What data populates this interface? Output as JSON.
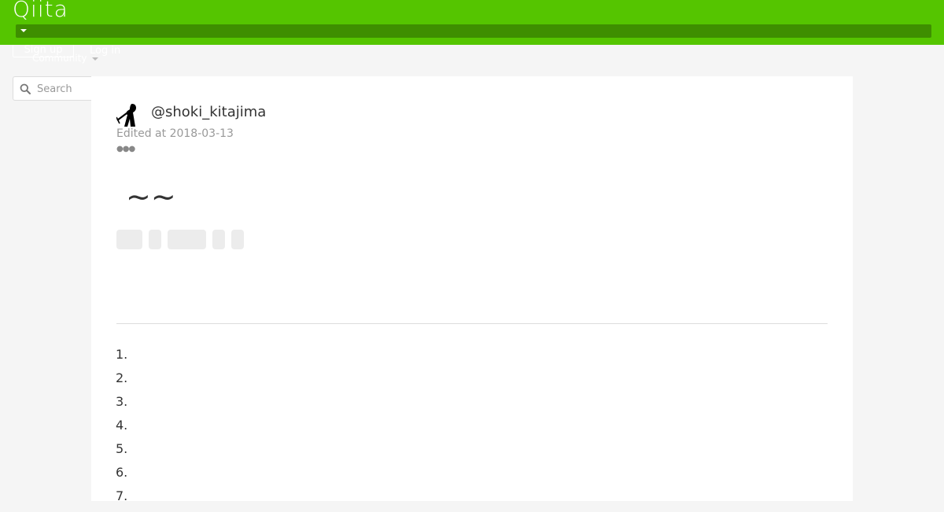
{
  "header": {
    "logo_text": "Qiita",
    "signup_label": "Sign up",
    "login_label": "Log in",
    "community_label": "Community",
    "brand_color": "#55c500"
  },
  "search": {
    "placeholder": "Search",
    "icon": "search-icon"
  },
  "article": {
    "author": "@shoki_kitajima",
    "edited": "Edited at 2018-03-13",
    "title": "~~",
    "tag_count": 5,
    "toc": [
      "1.",
      "2.",
      "3.",
      "4.",
      "5.",
      "6.",
      "7."
    ]
  }
}
